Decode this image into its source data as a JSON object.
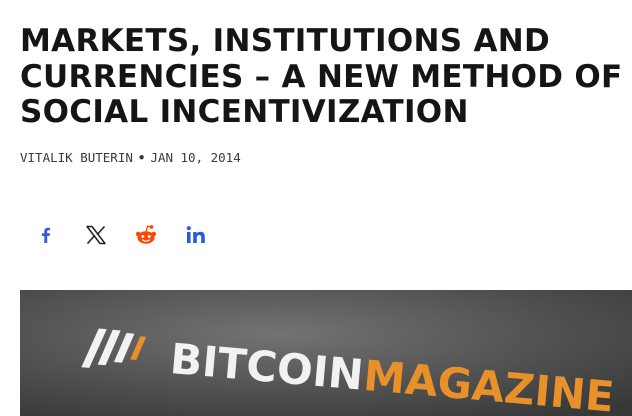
{
  "article": {
    "title": "MARKETS, INSTITUTIONS AND CURRENCIES – A NEW METHOD OF SOCIAL INCENTIVIZATION",
    "author": "VITALIK BUTERIN",
    "separator": "•",
    "date": "JAN 10, 2014"
  },
  "share": {
    "buttons": [
      {
        "network": "facebook",
        "icon": "facebook-icon"
      },
      {
        "network": "x",
        "icon": "x-icon"
      },
      {
        "network": "reddit",
        "icon": "reddit-icon"
      },
      {
        "network": "linkedin",
        "icon": "linkedin-icon"
      }
    ],
    "colors": {
      "facebook": "#3b5bd6",
      "x": "#222222",
      "reddit": "#ff4500",
      "linkedin": "#2a5bd7"
    }
  },
  "hero": {
    "logo_text_white": "BITCOIN",
    "logo_text_orange": "MAGAZINE",
    "accent": "#e8912a"
  }
}
